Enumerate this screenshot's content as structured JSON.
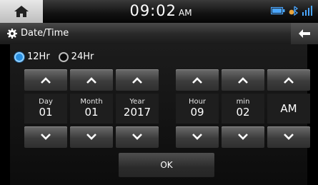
{
  "status": {
    "time": "09:02",
    "ampm": "AM"
  },
  "header": {
    "title": "Date/Time"
  },
  "format": {
    "option_12": "12Hr",
    "option_24": "24Hr",
    "selected": "12Hr"
  },
  "fields": {
    "day": {
      "label": "Day",
      "value": "01"
    },
    "month": {
      "label": "Month",
      "value": "01"
    },
    "year": {
      "label": "Year",
      "value": "2017"
    },
    "hour": {
      "label": "Hour",
      "value": "09"
    },
    "minute": {
      "label": "min",
      "value": "02"
    },
    "period": {
      "value": "AM"
    }
  },
  "actions": {
    "ok": "OK"
  },
  "icons": [
    "home-icon",
    "battery-icon",
    "bluetooth-icon",
    "signal-icon",
    "gear-icon",
    "back-arrow-icon",
    "chevron-up-icon",
    "chevron-down-icon"
  ],
  "colors": {
    "accent": "#2a8fe0",
    "bar_dark": "#111111"
  }
}
